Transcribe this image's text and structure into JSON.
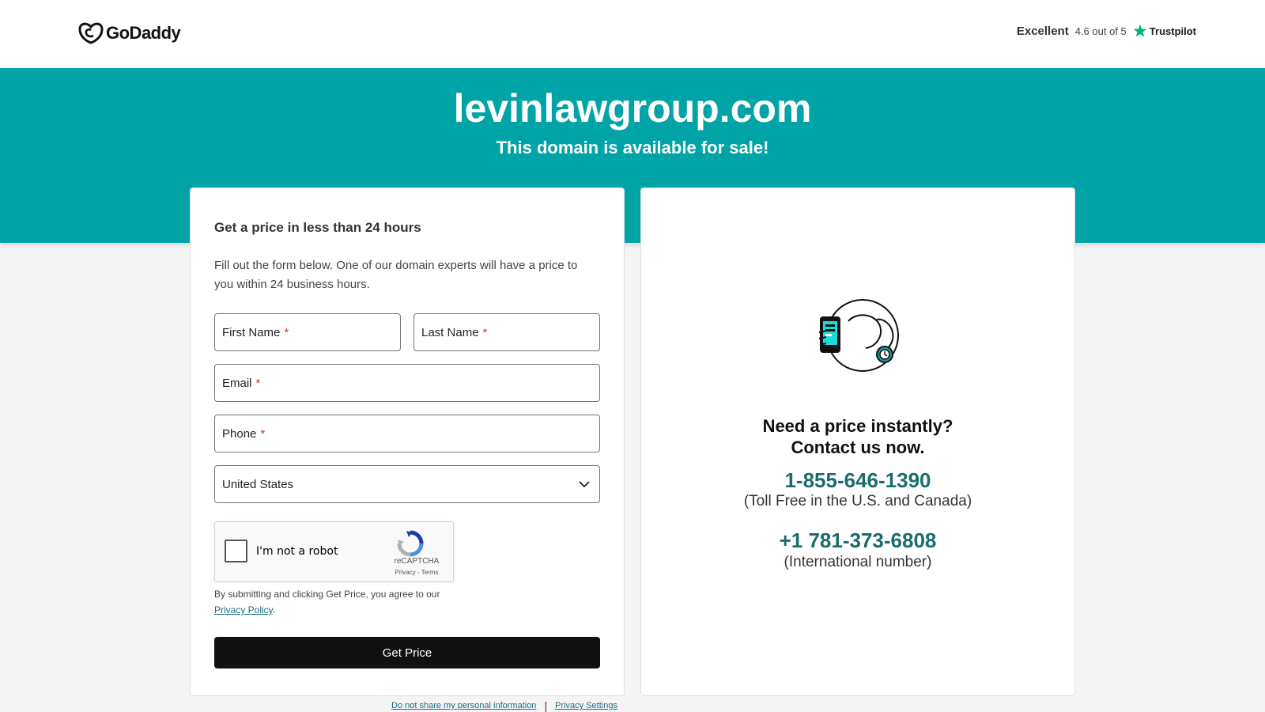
{
  "header": {
    "logo_text": "GoDaddy",
    "trust_rating": "Excellent",
    "trust_score": "4.6 out of 5",
    "trust_brand": "Trustpilot"
  },
  "hero": {
    "domain": "levinlawgroup.com",
    "subtitle": "This domain is available for sale!"
  },
  "form": {
    "title": "Get a price in less than 24 hours",
    "description": "Fill out the form below. One of our domain experts will have a price to you within 24 business hours.",
    "first_name_label": "First Name",
    "last_name_label": "Last Name",
    "email_label": "Email",
    "phone_label": "Phone",
    "required_mark": "*",
    "country_value": "United States",
    "captcha_label": "I'm not a robot",
    "captcha_brand": "reCAPTCHA",
    "captcha_links": "Privacy - Terms",
    "terms_text": "By submitting and clicking Get Price, you agree to our",
    "privacy_link": "Privacy Policy",
    "terms_end": ".",
    "submit_label": "Get Price"
  },
  "contact": {
    "heading_line1": "Need a price instantly?",
    "heading_line2": "Contact us now.",
    "phone_tollfree": "1-855-646-1390",
    "phone_tollfree_note": "(Toll Free in the U.S. and Canada)",
    "phone_intl": "+1 781-373-6808",
    "phone_intl_note": "(International number)"
  },
  "footer": {
    "do_not_share": "Do not share my personal information",
    "separator": "|",
    "privacy_settings": "Privacy Settings"
  },
  "colors": {
    "brand_teal": "#00a4a6",
    "phone_teal": "#1a6d6e",
    "button_black": "#111111",
    "required_red": "#d0342c"
  }
}
